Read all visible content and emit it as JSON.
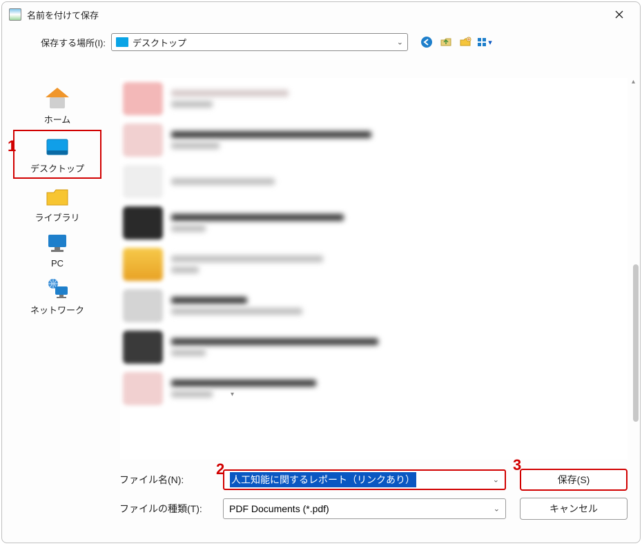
{
  "title": "名前を付けて保存",
  "location": {
    "label": "保存する場所(I):",
    "value": "デスクトップ"
  },
  "places": [
    {
      "id": "home",
      "label": "ホーム"
    },
    {
      "id": "desktop",
      "label": "デスクトップ",
      "selected": true
    },
    {
      "id": "library",
      "label": "ライブラリ"
    },
    {
      "id": "pc",
      "label": "PC"
    },
    {
      "id": "network",
      "label": "ネットワーク"
    }
  ],
  "filename": {
    "label": "ファイル名(N):",
    "value": "人工知能に関するレポート（リンクあり）"
  },
  "filetype": {
    "label": "ファイルの種類(T):",
    "value": "PDF Documents (*.pdf)"
  },
  "buttons": {
    "save": "保存(S)",
    "cancel": "キャンセル"
  },
  "annotations": {
    "n1": "1",
    "n2": "2",
    "n3": "3"
  }
}
